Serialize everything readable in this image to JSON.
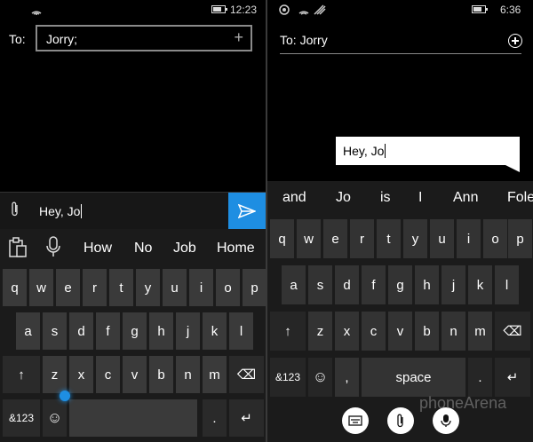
{
  "left": {
    "status": {
      "time": "12:23"
    },
    "to_label": "To:",
    "to_value": "Jorry;",
    "to_add": "+",
    "message": "Hey, Jo",
    "suggestions": [
      "How",
      "No",
      "Job",
      "Home"
    ],
    "keys": {
      "row1": [
        "q",
        "w",
        "e",
        "r",
        "t",
        "y",
        "u",
        "i",
        "o",
        "p"
      ],
      "row2": [
        "a",
        "s",
        "d",
        "f",
        "g",
        "h",
        "j",
        "k",
        "l"
      ],
      "row3": [
        "↑",
        "z",
        "x",
        "c",
        "v",
        "b",
        "n",
        "m",
        "⌫"
      ],
      "row4": [
        "&123",
        "☺",
        "",
        ".",
        "↵"
      ]
    }
  },
  "right": {
    "status": {
      "time": "6:36"
    },
    "to_label": "To:",
    "to_value": "Jorry",
    "message": "Hey, Jo",
    "suggestions": [
      "and",
      "Jo",
      "is",
      "I",
      "Ann",
      "Fole"
    ],
    "keys": {
      "row1": [
        "q",
        "w",
        "e",
        "r",
        "t",
        "y",
        "u",
        "i",
        "o",
        "p"
      ],
      "row2": [
        "a",
        "s",
        "d",
        "f",
        "g",
        "h",
        "j",
        "k",
        "l"
      ],
      "row3": [
        "↑",
        "z",
        "x",
        "c",
        "v",
        "b",
        "n",
        "m",
        "⌫"
      ],
      "row4": [
        "&123",
        "☺",
        ",",
        "space",
        ".",
        "↵"
      ]
    }
  },
  "watermark": "phoneArena"
}
